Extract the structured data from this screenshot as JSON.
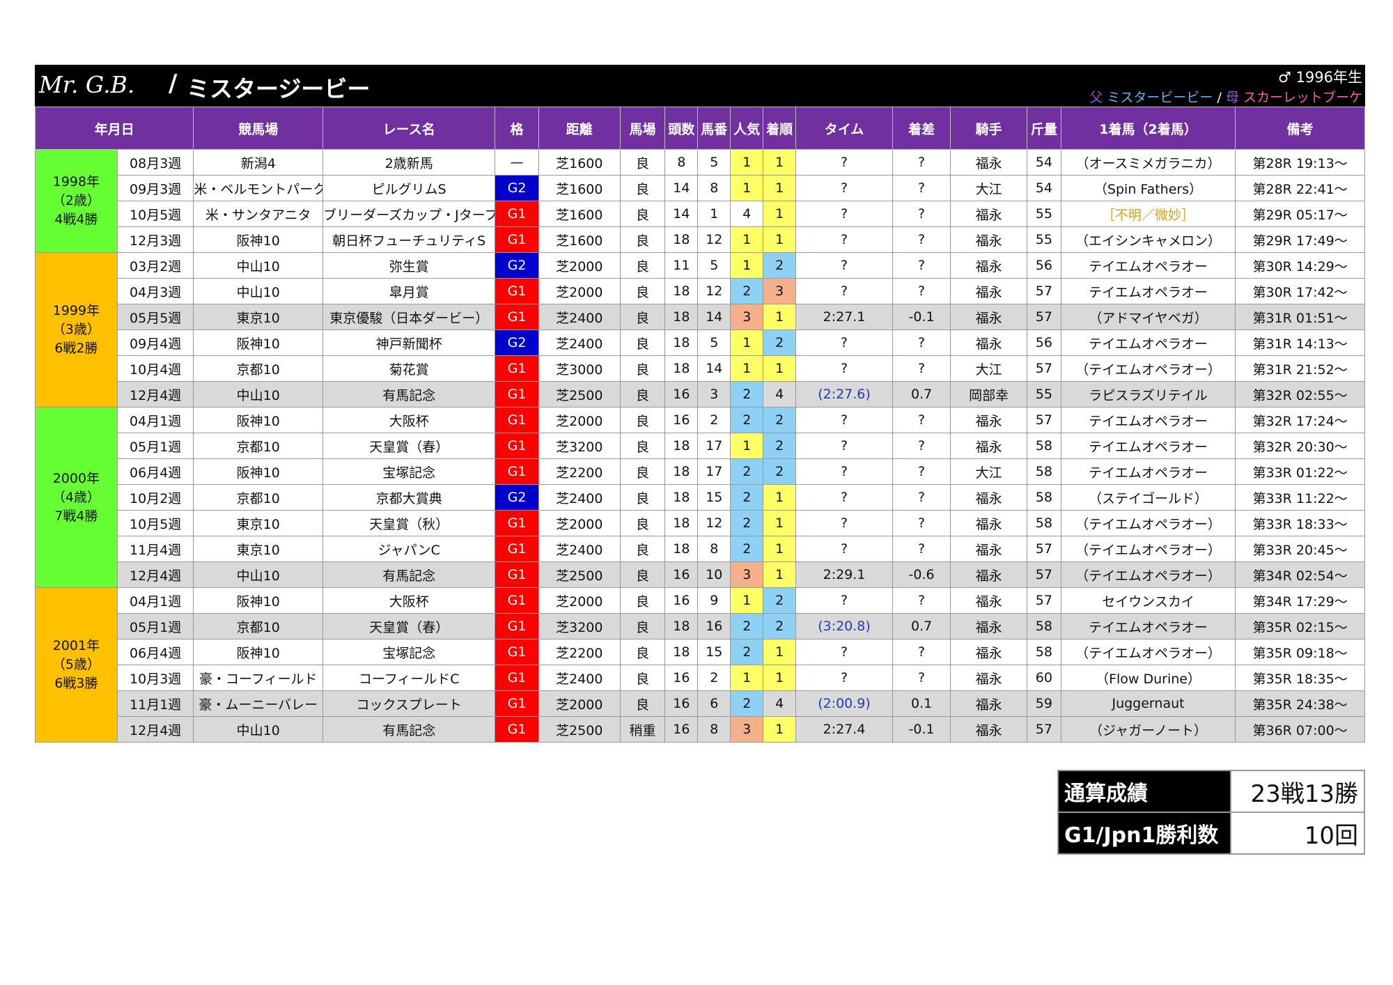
{
  "header": {
    "name_en": "Mr. G.B.",
    "separator": "/",
    "name_jp": "ミスタージービー",
    "born": "♂ 1996年生",
    "sire_label": "父",
    "sire": "ミスタービービー",
    "ped_sep": "/",
    "dam_label": "母",
    "dam": "スカーレットブーケ"
  },
  "columns": [
    "年月日",
    "競馬場",
    "レース名",
    "格",
    "距離",
    "馬場",
    "頭数",
    "馬番",
    "人気",
    "着順",
    "タイム",
    "着差",
    "騎手",
    "斤量",
    "1着馬（2着馬）",
    "備考"
  ],
  "groups": [
    {
      "label": [
        "1998年",
        "（2歳）",
        "4戦4勝"
      ],
      "color": "#66ff33"
    },
    {
      "label": [
        "1999年",
        "（3歳）",
        "6戦2勝"
      ],
      "color": "#ffc000"
    },
    {
      "label": [
        "2000年",
        "（4歳）",
        "7戦4勝"
      ],
      "color": "#66ff33"
    },
    {
      "label": [
        "2001年",
        "（5歳）",
        "6戦3勝"
      ],
      "color": "#ffc000"
    }
  ],
  "rows": [
    {
      "g": 0,
      "date": "08月3週",
      "course": "新潟4",
      "race": "2歳新馬",
      "grade": "—",
      "dist": "芝1600",
      "track": "良",
      "field": "8",
      "num": "5",
      "pop": "1",
      "fin": "1",
      "time": "?",
      "margin": "?",
      "jockey": "福永",
      "wt": "54",
      "winner": "（オースミメガラニカ）",
      "note": "第28R 19:13～",
      "shade": false
    },
    {
      "g": 0,
      "date": "09月3週",
      "course": "米・ベルモントパーク",
      "race": "ピルグリムS",
      "grade": "G2",
      "dist": "芝1600",
      "track": "良",
      "field": "14",
      "num": "8",
      "pop": "1",
      "fin": "1",
      "time": "?",
      "margin": "?",
      "jockey": "大江",
      "wt": "54",
      "winner": "（Spin Fathers）",
      "note": "第28R 22:41～",
      "shade": false
    },
    {
      "g": 0,
      "date": "10月5週",
      "course": "米・サンタアニタ",
      "race": "ブリーダーズカップ・Jターフ",
      "grade": "G1",
      "dist": "芝1600",
      "track": "良",
      "field": "14",
      "num": "1",
      "pop": "4",
      "fin": "1",
      "time": "?",
      "margin": "?",
      "jockey": "福永",
      "wt": "55",
      "winner": "［不明／微妙］",
      "note": "第29R 05:17～",
      "shade": false,
      "winnerGold": true
    },
    {
      "g": 0,
      "date": "12月3週",
      "course": "阪神10",
      "race": "朝日杯フューチュリティS",
      "grade": "G1",
      "dist": "芝1600",
      "track": "良",
      "field": "18",
      "num": "12",
      "pop": "1",
      "fin": "1",
      "time": "?",
      "margin": "?",
      "jockey": "福永",
      "wt": "55",
      "winner": "（エイシンキャメロン）",
      "note": "第29R 17:49～",
      "shade": false
    },
    {
      "g": 1,
      "date": "03月2週",
      "course": "中山10",
      "race": "弥生賞",
      "grade": "G2",
      "dist": "芝2000",
      "track": "良",
      "field": "11",
      "num": "5",
      "pop": "1",
      "fin": "2",
      "time": "?",
      "margin": "?",
      "jockey": "福永",
      "wt": "56",
      "winner": "テイエムオペラオー",
      "note": "第30R 14:29～",
      "shade": false
    },
    {
      "g": 1,
      "date": "04月3週",
      "course": "中山10",
      "race": "皐月賞",
      "grade": "G1",
      "dist": "芝2000",
      "track": "良",
      "field": "18",
      "num": "12",
      "pop": "2",
      "fin": "3",
      "time": "?",
      "margin": "?",
      "jockey": "福永",
      "wt": "57",
      "winner": "テイエムオペラオー",
      "note": "第30R 17:42～",
      "shade": false
    },
    {
      "g": 1,
      "date": "05月5週",
      "course": "東京10",
      "race": "東京優駿（日本ダービー）",
      "grade": "G1",
      "dist": "芝2400",
      "track": "良",
      "field": "18",
      "num": "14",
      "pop": "3",
      "fin": "1",
      "time": "2:27.1",
      "margin": "-0.1",
      "jockey": "福永",
      "wt": "57",
      "winner": "（アドマイヤベガ）",
      "note": "第31R 01:51～",
      "shade": true
    },
    {
      "g": 1,
      "date": "09月4週",
      "course": "阪神10",
      "race": "神戸新聞杯",
      "grade": "G2",
      "dist": "芝2400",
      "track": "良",
      "field": "18",
      "num": "5",
      "pop": "1",
      "fin": "2",
      "time": "?",
      "margin": "?",
      "jockey": "福永",
      "wt": "56",
      "winner": "テイエムオペラオー",
      "note": "第31R 14:13～",
      "shade": false
    },
    {
      "g": 1,
      "date": "10月4週",
      "course": "京都10",
      "race": "菊花賞",
      "grade": "G1",
      "dist": "芝3000",
      "track": "良",
      "field": "18",
      "num": "14",
      "pop": "1",
      "fin": "1",
      "time": "?",
      "margin": "?",
      "jockey": "大江",
      "wt": "57",
      "winner": "（テイエムオペラオー）",
      "note": "第31R 21:52～",
      "shade": false
    },
    {
      "g": 1,
      "date": "12月4週",
      "course": "中山10",
      "race": "有馬記念",
      "grade": "G1",
      "dist": "芝2500",
      "track": "良",
      "field": "16",
      "num": "3",
      "pop": "2",
      "fin": "4",
      "time": "(2:27.6)",
      "margin": "0.7",
      "jockey": "岡部幸",
      "wt": "55",
      "winner": "ラピスラズリテイル",
      "note": "第32R 02:55～",
      "shade": true,
      "timeBlue": true
    },
    {
      "g": 2,
      "date": "04月1週",
      "course": "阪神10",
      "race": "大阪杯",
      "grade": "G1",
      "dist": "芝2000",
      "track": "良",
      "field": "16",
      "num": "2",
      "pop": "2",
      "fin": "2",
      "time": "?",
      "margin": "?",
      "jockey": "福永",
      "wt": "57",
      "winner": "テイエムオペラオー",
      "note": "第32R 17:24～",
      "shade": false
    },
    {
      "g": 2,
      "date": "05月1週",
      "course": "京都10",
      "race": "天皇賞（春）",
      "grade": "G1",
      "dist": "芝3200",
      "track": "良",
      "field": "18",
      "num": "17",
      "pop": "1",
      "fin": "2",
      "time": "?",
      "margin": "?",
      "jockey": "福永",
      "wt": "58",
      "winner": "テイエムオペラオー",
      "note": "第32R 20:30～",
      "shade": false
    },
    {
      "g": 2,
      "date": "06月4週",
      "course": "阪神10",
      "race": "宝塚記念",
      "grade": "G1",
      "dist": "芝2200",
      "track": "良",
      "field": "18",
      "num": "17",
      "pop": "2",
      "fin": "2",
      "time": "?",
      "margin": "?",
      "jockey": "大江",
      "wt": "58",
      "winner": "テイエムオペラオー",
      "note": "第33R 01:22～",
      "shade": false
    },
    {
      "g": 2,
      "date": "10月2週",
      "course": "京都10",
      "race": "京都大賞典",
      "grade": "G2",
      "dist": "芝2400",
      "track": "良",
      "field": "18",
      "num": "15",
      "pop": "2",
      "fin": "1",
      "time": "?",
      "margin": "?",
      "jockey": "福永",
      "wt": "58",
      "winner": "（ステイゴールド）",
      "note": "第33R 11:22～",
      "shade": false
    },
    {
      "g": 2,
      "date": "10月5週",
      "course": "東京10",
      "race": "天皇賞（秋）",
      "grade": "G1",
      "dist": "芝2000",
      "track": "良",
      "field": "18",
      "num": "12",
      "pop": "2",
      "fin": "1",
      "time": "?",
      "margin": "?",
      "jockey": "福永",
      "wt": "58",
      "winner": "（テイエムオペラオー）",
      "note": "第33R 18:33～",
      "shade": false
    },
    {
      "g": 2,
      "date": "11月4週",
      "course": "東京10",
      "race": "ジャパンC",
      "grade": "G1",
      "dist": "芝2400",
      "track": "良",
      "field": "18",
      "num": "8",
      "pop": "2",
      "fin": "1",
      "time": "?",
      "margin": "?",
      "jockey": "福永",
      "wt": "57",
      "winner": "（テイエムオペラオー）",
      "note": "第33R 20:45～",
      "shade": false
    },
    {
      "g": 2,
      "date": "12月4週",
      "course": "中山10",
      "race": "有馬記念",
      "grade": "G1",
      "dist": "芝2500",
      "track": "良",
      "field": "16",
      "num": "10",
      "pop": "3",
      "fin": "1",
      "time": "2:29.1",
      "margin": "-0.6",
      "jockey": "福永",
      "wt": "57",
      "winner": "（テイエムオペラオー）",
      "note": "第34R 02:54～",
      "shade": true
    },
    {
      "g": 3,
      "date": "04月1週",
      "course": "阪神10",
      "race": "大阪杯",
      "grade": "G1",
      "dist": "芝2000",
      "track": "良",
      "field": "16",
      "num": "9",
      "pop": "1",
      "fin": "2",
      "time": "?",
      "margin": "?",
      "jockey": "福永",
      "wt": "57",
      "winner": "セイウンスカイ",
      "note": "第34R 17:29～",
      "shade": false
    },
    {
      "g": 3,
      "date": "05月1週",
      "course": "京都10",
      "race": "天皇賞（春）",
      "grade": "G1",
      "dist": "芝3200",
      "track": "良",
      "field": "18",
      "num": "16",
      "pop": "2",
      "fin": "2",
      "time": "(3:20.8)",
      "margin": "0.7",
      "jockey": "福永",
      "wt": "58",
      "winner": "テイエムオペラオー",
      "note": "第35R 02:15～",
      "shade": true,
      "timeBlue": true
    },
    {
      "g": 3,
      "date": "06月4週",
      "course": "阪神10",
      "race": "宝塚記念",
      "grade": "G1",
      "dist": "芝2200",
      "track": "良",
      "field": "18",
      "num": "15",
      "pop": "2",
      "fin": "1",
      "time": "?",
      "margin": "?",
      "jockey": "福永",
      "wt": "58",
      "winner": "（テイエムオペラオー）",
      "note": "第35R 09:18～",
      "shade": false
    },
    {
      "g": 3,
      "date": "10月3週",
      "course": "豪・コーフィールド",
      "race": "コーフィールドC",
      "grade": "G1",
      "dist": "芝2400",
      "track": "良",
      "field": "16",
      "num": "2",
      "pop": "1",
      "fin": "1",
      "time": "?",
      "margin": "?",
      "jockey": "福永",
      "wt": "60",
      "winner": "（Flow Durine）",
      "note": "第35R 18:35～",
      "shade": false
    },
    {
      "g": 3,
      "date": "11月1週",
      "course": "豪・ムーニーバレー",
      "race": "コックスプレート",
      "grade": "G1",
      "dist": "芝2000",
      "track": "良",
      "field": "16",
      "num": "6",
      "pop": "2",
      "fin": "4",
      "time": "(2:00.9)",
      "margin": "0.1",
      "jockey": "福永",
      "wt": "59",
      "winner": "Juggernaut",
      "note": "第35R 24:38～",
      "shade": true,
      "timeBlue": true
    },
    {
      "g": 3,
      "date": "12月4週",
      "course": "中山10",
      "race": "有馬記念",
      "grade": "G1",
      "dist": "芝2500",
      "track": "稍重",
      "field": "16",
      "num": "8",
      "pop": "3",
      "fin": "1",
      "time": "2:27.4",
      "margin": "-0.1",
      "jockey": "福永",
      "wt": "57",
      "winner": "（ジャガーノート）",
      "note": "第36R 07:00～",
      "shade": true
    }
  ],
  "summary": {
    "record_label": "通算成績",
    "record_value": "23戦13勝",
    "g1_label": "G1/Jpn1勝利数",
    "g1_value": "10回"
  }
}
